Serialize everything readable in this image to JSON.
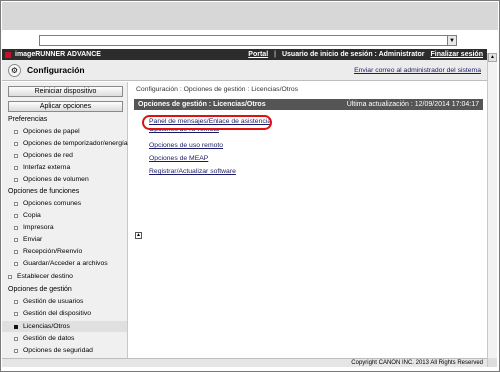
{
  "browser": {
    "address_value": "",
    "dropdown_icon": "chevron-down-icon"
  },
  "header": {
    "product": "imageRUNNER ADVANCE",
    "portal": "Portal",
    "login_user": "Usuario de inicio de sesión : Administrator",
    "logout": "Finalizar sesión"
  },
  "titlebar": {
    "title": "Configuración",
    "mail_admin": "Enviar correo al administrador del sistema"
  },
  "sidebar": {
    "restart_button": "Reiniciar dispositivo",
    "apply_button": "Aplicar opciones",
    "preferences": {
      "title": "Preferencias",
      "items": [
        "Opciones de papel",
        "Opciones de temporizador/energía",
        "Opciones de red",
        "Interfaz externa",
        "Opciones de volumen"
      ]
    },
    "functions": {
      "title": "Opciones de funciones",
      "items": [
        "Opciones comunes",
        "Copia",
        "Impresora",
        "Enviar",
        "Recepción/Reenvío",
        "Guardar/Acceder a archivos"
      ]
    },
    "establecer": "Establecer destino",
    "management": {
      "title": "Opciones de gestión",
      "items": [
        "Gestión de usuarios",
        "Gestión del dispositivo",
        "Licencias/Otros",
        "Gestión de datos",
        "Opciones de seguridad"
      ],
      "active_index": 2
    }
  },
  "main": {
    "breadcrumb": "Configuración : Opciones de gestión : Licencias/Otros",
    "section_title": "Opciones de gestión : Licencias/Otros",
    "last_update": "Última actualización : 12/09/2014 17:04:17",
    "links": [
      "Panel de mensajes/Enlace de asistencia",
      "Opciones de IU remota",
      "Opciones de uso remoto",
      "Opciones de MEAP",
      "Registrar/Actualizar software"
    ],
    "highlight_color": "#e01010"
  },
  "footer": {
    "copyright": "Copyright CANON INC. 2013 All Rights Reserved"
  }
}
